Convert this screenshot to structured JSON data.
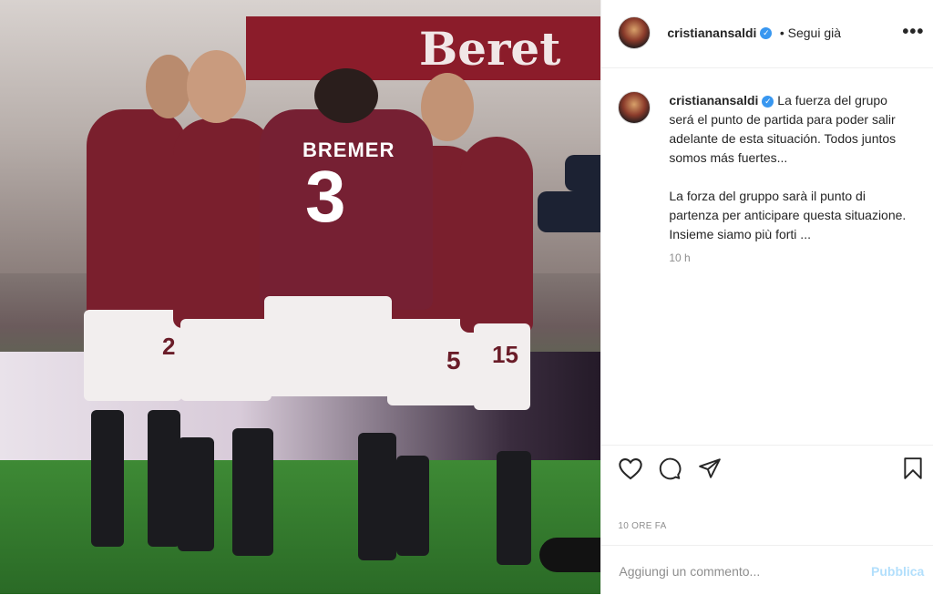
{
  "post": {
    "image": {
      "description_labels": {
        "banner_text": "Beret",
        "jersey_name": "BREMER",
        "jersey_number": "3",
        "short_numbers": [
          "2",
          "5",
          "15"
        ]
      }
    },
    "header": {
      "username": "cristianansaldi",
      "follow_label": "• Segui già",
      "more_label": "•••"
    },
    "caption": {
      "username": "cristianansaldi",
      "text_es": "La fuerza del grupo será el punto de partida para poder salir adelante de esta situación. Todos juntos somos más fuertes...",
      "text_it": "La forza del gruppo sarà il punto di partenza per anticipare questa situazione. Insieme siamo più forti ...",
      "time": "10 h"
    },
    "timestamp": "10 ORE FA",
    "comment": {
      "placeholder": "Aggiungi un commento...",
      "publish_label": "Pubblica"
    },
    "colors": {
      "verified": "#3897f0",
      "publish": "#b2dffc",
      "jersey": "#7a1f2d"
    }
  }
}
